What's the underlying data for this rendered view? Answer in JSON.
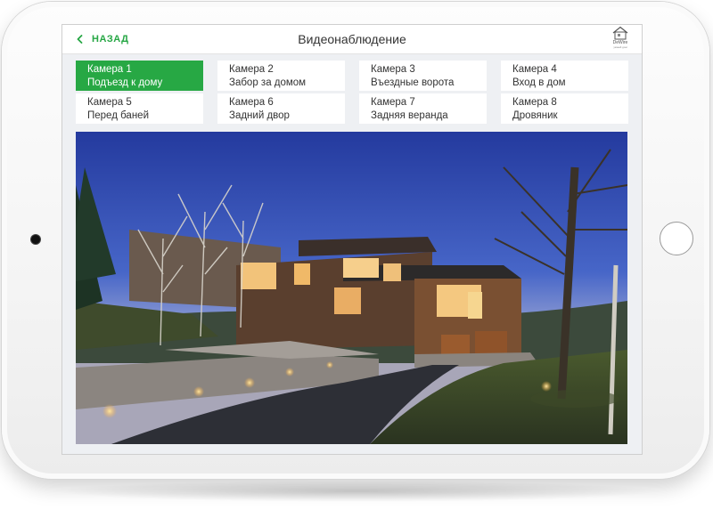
{
  "header": {
    "back_label": "НАЗАД",
    "title": "Видеонаблюдение",
    "logo_brand": "DeWire",
    "logo_sub": "умный дом"
  },
  "cameras": [
    {
      "name": "Камера 1",
      "location": "Подъезд к дому",
      "active": true
    },
    {
      "name": "Камера 2",
      "location": "Забор за домом",
      "active": false
    },
    {
      "name": "Камера 3",
      "location": "Въездные ворота",
      "active": false
    },
    {
      "name": "Камера 4",
      "location": "Вход в дом",
      "active": false
    },
    {
      "name": "Камера 5",
      "location": "Перед баней",
      "active": false
    },
    {
      "name": "Камера 6",
      "location": "Задний двор",
      "active": false
    },
    {
      "name": "Камера 7",
      "location": "Задняя веранда",
      "active": false
    },
    {
      "name": "Камера 8",
      "location": "Дровяник",
      "active": false
    }
  ],
  "colors": {
    "accent": "#27a844",
    "sky": "#2c43a3"
  },
  "icons": {
    "back": "chevron-left-icon",
    "logo": "house-logo-icon",
    "home_button": "home-button"
  }
}
